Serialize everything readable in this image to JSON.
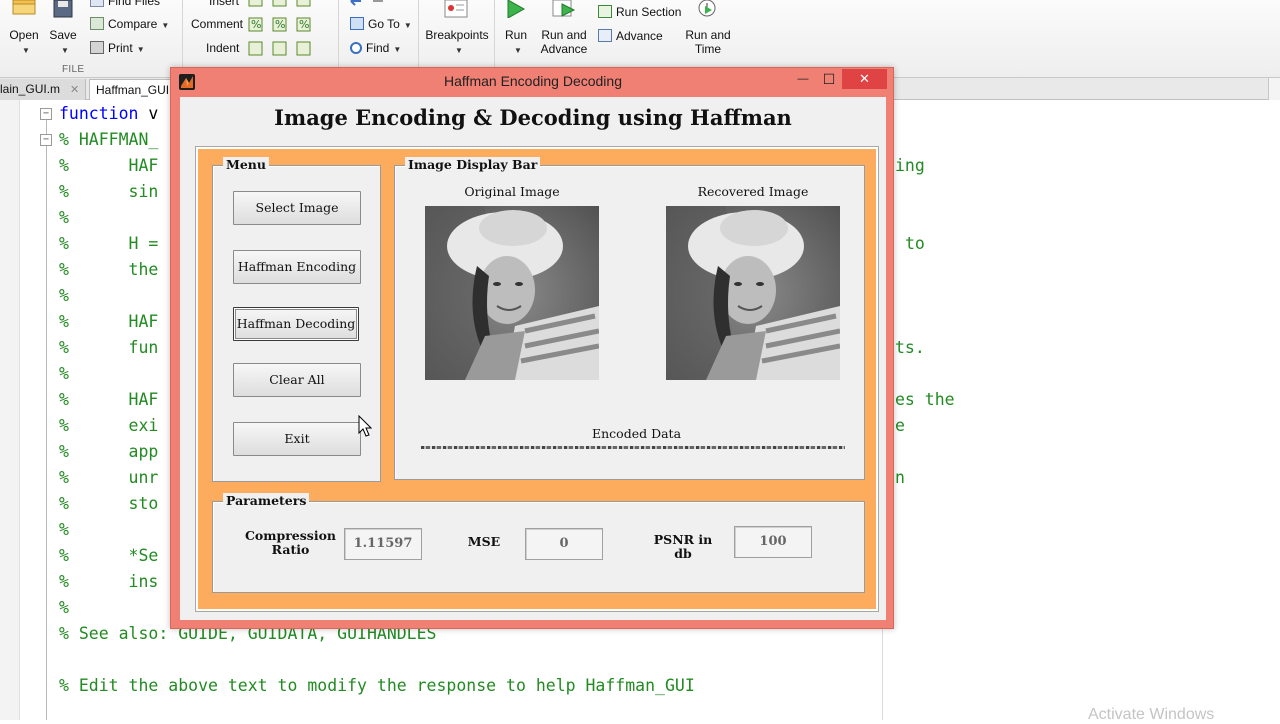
{
  "toolstrip": {
    "open_label": "Open",
    "save_label": "Save",
    "find_files_label": "Find Files",
    "compare_label": "Compare",
    "print_label": "Print",
    "file_section_label": "FILE",
    "insert_label": "Insert",
    "comment_label": "Comment",
    "indent_label": "Indent",
    "goto_label": "Go To",
    "find_label": "Find",
    "breakpoints_label": "Breakpoints",
    "run_label": "Run",
    "run_and_advance_label": "Run and\nAdvance",
    "run_section_label": "Run Section",
    "advance_label": "Advance",
    "run_and_time_label": "Run and\nTime"
  },
  "tabs": [
    {
      "label": "lain_GUI.m"
    },
    {
      "label": "Haffman_GUI"
    }
  ],
  "editor": {
    "lines": [
      {
        "kw": "function",
        "rest": " v"
      },
      {
        "comment": "% HAFFMAN_"
      },
      {
        "comment": "%      HAF"
      },
      {
        "comment": "%      sin"
      },
      {
        "comment": "%"
      },
      {
        "comment": "%      H ="
      },
      {
        "comment": "%      the"
      },
      {
        "comment": "%"
      },
      {
        "comment": "%      HAF"
      },
      {
        "comment": "%      fun"
      },
      {
        "comment": "%"
      },
      {
        "comment": "%      HAF"
      },
      {
        "comment": "%      exi"
      },
      {
        "comment": "%      app"
      },
      {
        "comment": "%      unr"
      },
      {
        "comment": "%      sto"
      },
      {
        "comment": "%"
      },
      {
        "comment": "%      *Se"
      },
      {
        "comment": "%      ins"
      },
      {
        "comment": "%"
      },
      {
        "comment": "% See also: GUIDE, GUIDATA, GUIHANDLES"
      },
      {
        "comment": ""
      },
      {
        "comment": "% Edit the above text to modify the response to help Haffman_GUI"
      }
    ],
    "right_fragments": [
      "ing",
      "to",
      "ts.",
      "es the",
      "e",
      "n"
    ],
    "watermark": "Activate Windows"
  },
  "figure": {
    "window_title": "Haffman Encoding Decoding",
    "minimize": "—",
    "maximize": "☐",
    "close": "✕",
    "heading": "Image Encoding & Decoding using Haffman",
    "menu": {
      "title": "Menu",
      "buttons": [
        "Select Image",
        "Haffman Encoding",
        "Haffman Decoding",
        "Clear All",
        "Exit"
      ]
    },
    "display": {
      "title": "Image Display Bar",
      "original_label": "Original Image",
      "recovered_label": "Recovered Image",
      "encoded_label": "Encoded Data"
    },
    "parameters": {
      "title": "Parameters",
      "compression_label": "Compression\nRatio",
      "compression_value": "1.11597",
      "mse_label": "MSE",
      "mse_value": "0",
      "psnr_label": "PSNR in db",
      "psnr_value": "100"
    }
  },
  "colors": {
    "window_frame": "#f08074",
    "panel_orange": "#fdab5c",
    "comment_green": "#228b22",
    "keyword_blue": "#0000ff"
  }
}
